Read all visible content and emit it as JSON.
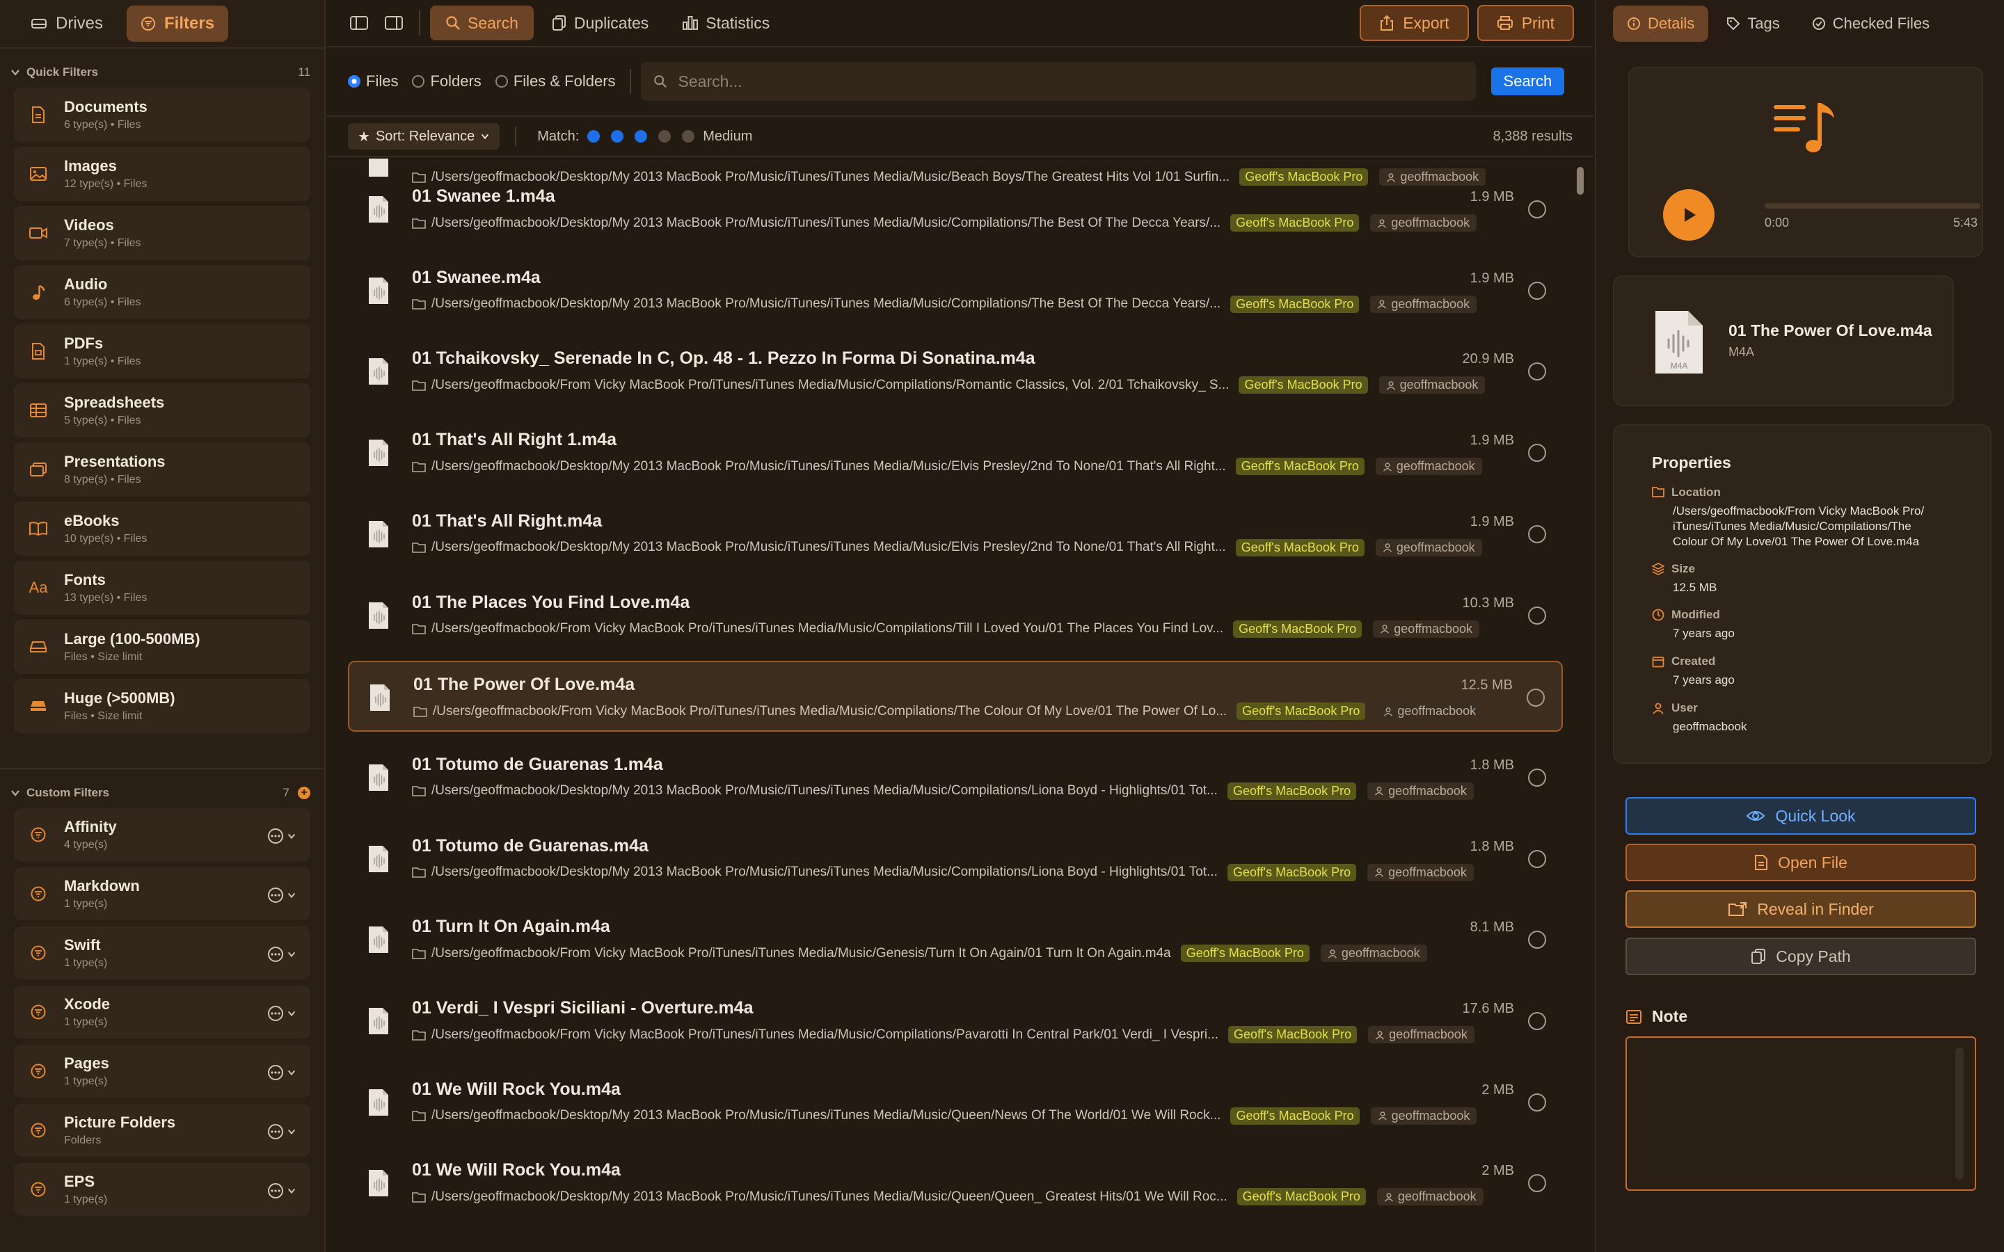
{
  "sidebar": {
    "tabs": [
      {
        "label": "Drives"
      },
      {
        "label": "Filters"
      }
    ],
    "quick_filters": {
      "title": "Quick Filters",
      "count": "11",
      "items": [
        {
          "label": "Documents",
          "sub": "6 type(s) • Files",
          "icon": "document-icon"
        },
        {
          "label": "Images",
          "sub": "12 type(s) • Files",
          "icon": "image-icon"
        },
        {
          "label": "Videos",
          "sub": "7 type(s) • Files",
          "icon": "video-icon"
        },
        {
          "label": "Audio",
          "sub": "6 type(s) • Files",
          "icon": "music-note-icon"
        },
        {
          "label": "PDFs",
          "sub": "1 type(s) • Files",
          "icon": "pdf-icon"
        },
        {
          "label": "Spreadsheets",
          "sub": "5 type(s) • Files",
          "icon": "table-icon"
        },
        {
          "label": "Presentations",
          "sub": "8 type(s) • Files",
          "icon": "slides-icon"
        },
        {
          "label": "eBooks",
          "sub": "10 type(s) • Files",
          "icon": "book-icon"
        },
        {
          "label": "Fonts",
          "sub": "13 type(s) • Files",
          "icon": "font-icon",
          "glyph": "Aa"
        },
        {
          "label": "Large (100-500MB)",
          "sub": "Files • Size limit",
          "icon": "drive-icon"
        },
        {
          "label": "Huge (>500MB)",
          "sub": "Files • Size limit",
          "icon": "drive-filled-icon"
        }
      ]
    },
    "custom_filters": {
      "title": "Custom Filters",
      "count": "7",
      "add": "+",
      "items": [
        {
          "label": "Affinity",
          "sub": "4 type(s)"
        },
        {
          "label": "Markdown",
          "sub": "1 type(s)"
        },
        {
          "label": "Swift",
          "sub": "1 type(s)"
        },
        {
          "label": "Xcode",
          "sub": "1 type(s)"
        },
        {
          "label": "Pages",
          "sub": "1 type(s)"
        },
        {
          "label": "Picture  Folders",
          "sub": "Folders"
        },
        {
          "label": "EPS",
          "sub": "1 type(s)"
        }
      ]
    }
  },
  "toolbar": {
    "modes": [
      {
        "label": "Search"
      },
      {
        "label": "Duplicates"
      },
      {
        "label": "Statistics"
      }
    ],
    "export_label": "Export",
    "print_label": "Print"
  },
  "search": {
    "scope": [
      {
        "label": "Files",
        "selected": true
      },
      {
        "label": "Folders",
        "selected": false
      },
      {
        "label": "Files & Folders",
        "selected": false
      }
    ],
    "placeholder": "Search...",
    "button": "Search"
  },
  "sort": {
    "label": "Sort: Relevance",
    "match_label": "Match:",
    "match_level": 3,
    "match_max": 5,
    "match_text": "Medium",
    "results": "8,388 results"
  },
  "list": {
    "drive_badge": "Geoff's MacBook Pro",
    "user_badge": "geoffmacbook",
    "partial_path": "/Users/geoffmacbook/Desktop/My 2013 MacBook Pro/Music/iTunes/iTunes Media/Music/Beach Boys/The Greatest Hits Vol 1/01 Surfin...",
    "rows": [
      {
        "name": "01 Swanee 1.m4a",
        "size": "1.9 MB",
        "path": "/Users/geoffmacbook/Desktop/My 2013 MacBook Pro/Music/iTunes/iTunes Media/Music/Compilations/The Best Of The Decca Years/..."
      },
      {
        "name": "01 Swanee.m4a",
        "size": "1.9 MB",
        "path": "/Users/geoffmacbook/Desktop/My 2013 MacBook Pro/Music/iTunes/iTunes Media/Music/Compilations/The Best Of The Decca Years/..."
      },
      {
        "name": "01 Tchaikovsky_ Serenade In C, Op. 48 - 1. Pezzo In Forma Di Sonatina.m4a",
        "size": "20.9 MB",
        "path": "/Users/geoffmacbook/From Vicky MacBook Pro/iTunes/iTunes Media/Music/Compilations/Romantic Classics, Vol. 2/01 Tchaikovsky_ S..."
      },
      {
        "name": "01 That's All Right 1.m4a",
        "size": "1.9 MB",
        "path": "/Users/geoffmacbook/Desktop/My 2013 MacBook Pro/Music/iTunes/iTunes Media/Music/Elvis Presley/2nd To None/01 That's All Right..."
      },
      {
        "name": "01 That's All Right.m4a",
        "size": "1.9 MB",
        "path": "/Users/geoffmacbook/Desktop/My 2013 MacBook Pro/Music/iTunes/iTunes Media/Music/Elvis Presley/2nd To None/01 That's All Right..."
      },
      {
        "name": "01 The Places You Find Love.m4a",
        "size": "10.3 MB",
        "path": "/Users/geoffmacbook/From Vicky MacBook Pro/iTunes/iTunes Media/Music/Compilations/Till I Loved You/01 The Places You Find Lov..."
      },
      {
        "name": "01 The Power Of Love.m4a",
        "size": "12.5 MB",
        "path": "/Users/geoffmacbook/From Vicky MacBook Pro/iTunes/iTunes Media/Music/Compilations/The Colour Of My Love/01 The Power Of Lo...",
        "selected": true
      },
      {
        "name": "01 Totumo de Guarenas 1.m4a",
        "size": "1.8 MB",
        "path": "/Users/geoffmacbook/Desktop/My 2013 MacBook Pro/Music/iTunes/iTunes Media/Music/Compilations/Liona Boyd - Highlights/01 Tot..."
      },
      {
        "name": "01 Totumo de Guarenas.m4a",
        "size": "1.8 MB",
        "path": "/Users/geoffmacbook/Desktop/My 2013 MacBook Pro/Music/iTunes/iTunes Media/Music/Compilations/Liona Boyd - Highlights/01 Tot..."
      },
      {
        "name": "01 Turn It On Again.m4a",
        "size": "8.1 MB",
        "path": "/Users/geoffmacbook/From Vicky MacBook Pro/iTunes/iTunes Media/Music/Genesis/Turn It On Again/01 Turn It On Again.m4a"
      },
      {
        "name": "01 Verdi_ I Vespri Siciliani - Overture.m4a",
        "size": "17.6 MB",
        "path": "/Users/geoffmacbook/From Vicky MacBook Pro/iTunes/iTunes Media/Music/Compilations/Pavarotti In Central Park/01 Verdi_ I Vespri..."
      },
      {
        "name": "01 We Will Rock You.m4a",
        "size": "2 MB",
        "path": "/Users/geoffmacbook/Desktop/My 2013 MacBook Pro/Music/iTunes/iTunes Media/Music/Queen/News Of The World/01 We Will Rock..."
      },
      {
        "name": "01 We Will Rock You.m4a",
        "size": "2 MB",
        "path": "/Users/geoffmacbook/Desktop/My 2013 MacBook Pro/Music/iTunes/iTunes Media/Music/Queen/Queen_ Greatest Hits/01 We Will Roc..."
      }
    ]
  },
  "details": {
    "tabs": [
      {
        "label": "Details"
      },
      {
        "label": "Tags"
      },
      {
        "label": "Checked Files"
      }
    ],
    "player": {
      "current": "0:00",
      "duration": "5:43",
      "progress": 0
    },
    "file": {
      "name": "01 The Power Of Love.m4a",
      "type": "M4A",
      "icon_label": "M4A"
    },
    "properties": {
      "title": "Properties",
      "items": [
        {
          "label": "Location",
          "value": "/Users/geoffmacbook/From Vicky MacBook Pro/\niTunes/iTunes Media/Music/Compilations/The\nColour Of My Love/01 The Power Of Love.m4a"
        },
        {
          "label": "Size",
          "value": "12.5 MB"
        },
        {
          "label": "Modified",
          "value": "7 years ago"
        },
        {
          "label": "Created",
          "value": "7 years ago"
        },
        {
          "label": "User",
          "value": "geoffmacbook"
        }
      ]
    },
    "actions": [
      {
        "label": "Quick Look"
      },
      {
        "label": "Open File"
      },
      {
        "label": "Reveal in Finder"
      },
      {
        "label": "Copy Path"
      }
    ],
    "note": {
      "title": "Note",
      "value": ""
    }
  },
  "colors": {
    "accent": "#e8882f",
    "selection": "#9b5a27",
    "search_blue": "#1a73e8",
    "drive_badge": "#e2e04a"
  }
}
